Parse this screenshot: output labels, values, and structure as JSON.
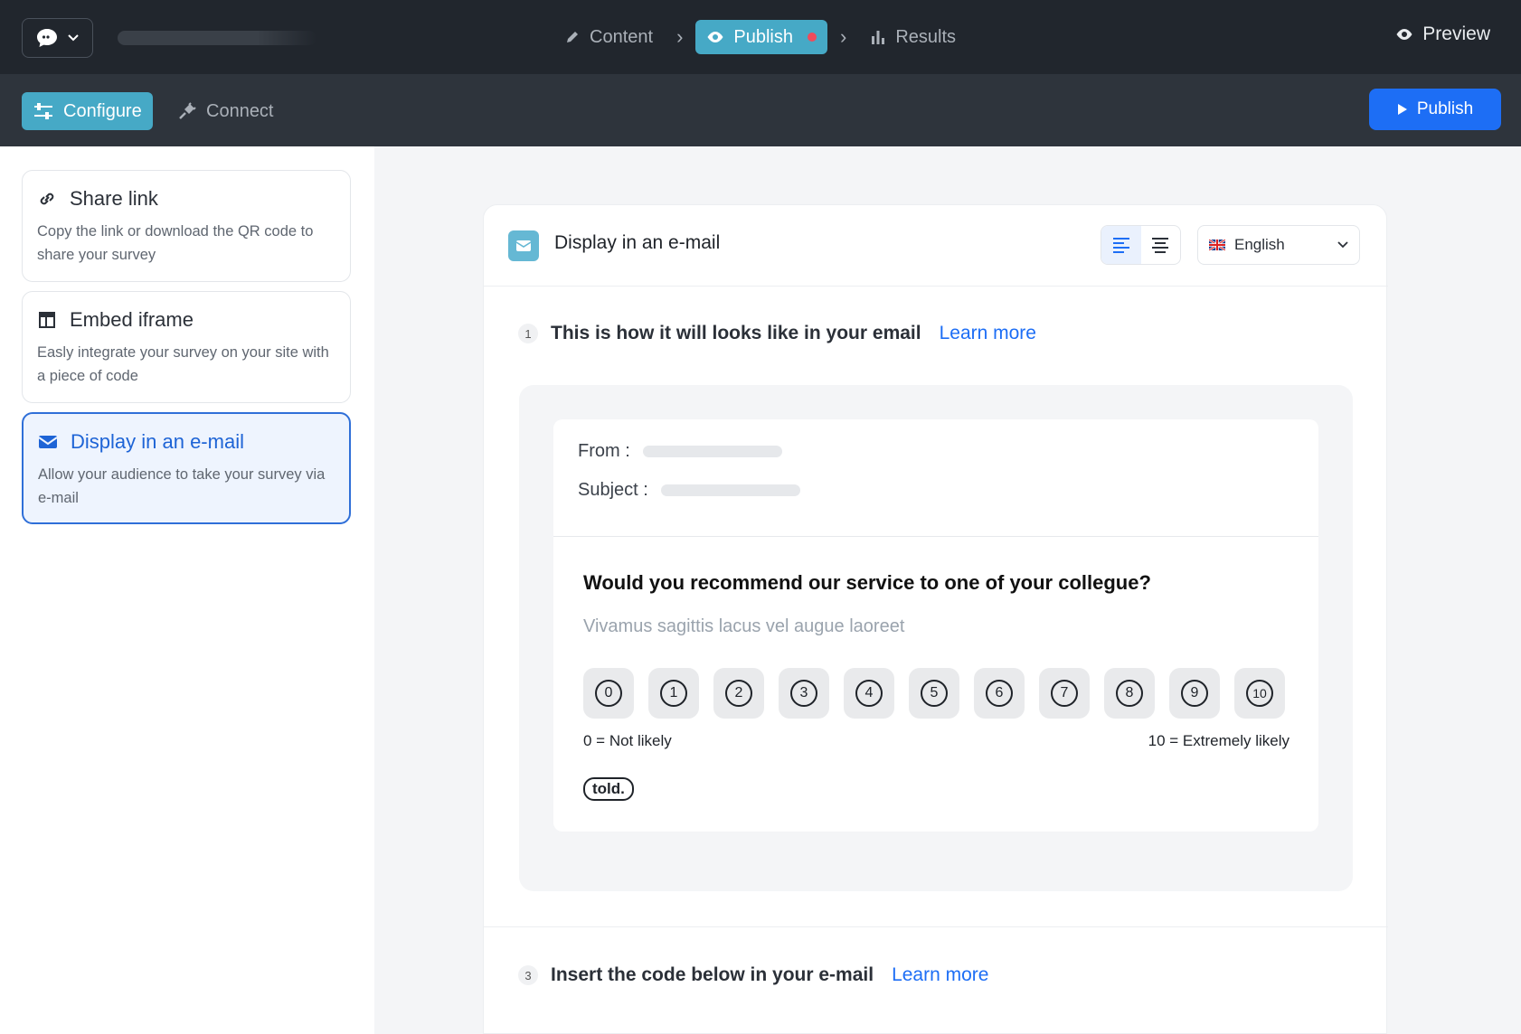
{
  "topbar": {
    "steps": [
      {
        "label": "Content",
        "icon": "pencil-icon"
      },
      {
        "label": "Publish",
        "icon": "eye-icon",
        "active": true
      },
      {
        "label": "Results",
        "icon": "bar-chart-icon"
      }
    ],
    "preview_label": "Preview"
  },
  "subbar": {
    "configure_label": "Configure",
    "connect_label": "Connect",
    "publish_label": "Publish"
  },
  "sidebar": {
    "items": [
      {
        "title": "Share link",
        "desc": "Copy the link or download the QR code to share your survey",
        "icon": "link-icon"
      },
      {
        "title": "Embed iframe",
        "desc": "Easly integrate your survey on your site with a piece of code",
        "icon": "layout-icon"
      },
      {
        "title": "Display in an e-mail",
        "desc": "Allow your audience to take your survey via e-mail",
        "icon": "mail-icon",
        "selected": true
      }
    ]
  },
  "panel": {
    "title": "Display in an e-mail",
    "language": "English",
    "section1": {
      "num": "1",
      "title": "This is how it will looks like in your email",
      "learn": "Learn more"
    },
    "section3": {
      "num": "3",
      "title": "Insert the code below in your e-mail",
      "learn": "Learn more"
    },
    "email": {
      "from_label": "From :",
      "subject_label": "Subject :",
      "question": "Would you recommend our service to one of your collegue?",
      "subtitle": "Vivamus sagittis lacus vel augue laoreet",
      "scale": [
        "0",
        "1",
        "2",
        "3",
        "4",
        "5",
        "6",
        "7",
        "8",
        "9",
        "10"
      ],
      "low_label": "0 = Not likely",
      "high_label": "10 = Extremely likely",
      "brand": "told."
    }
  },
  "colors": {
    "accent": "#46a9c6",
    "primary": "#1d6ef5",
    "topbar": "#21262d",
    "subbar": "#2e343c"
  }
}
